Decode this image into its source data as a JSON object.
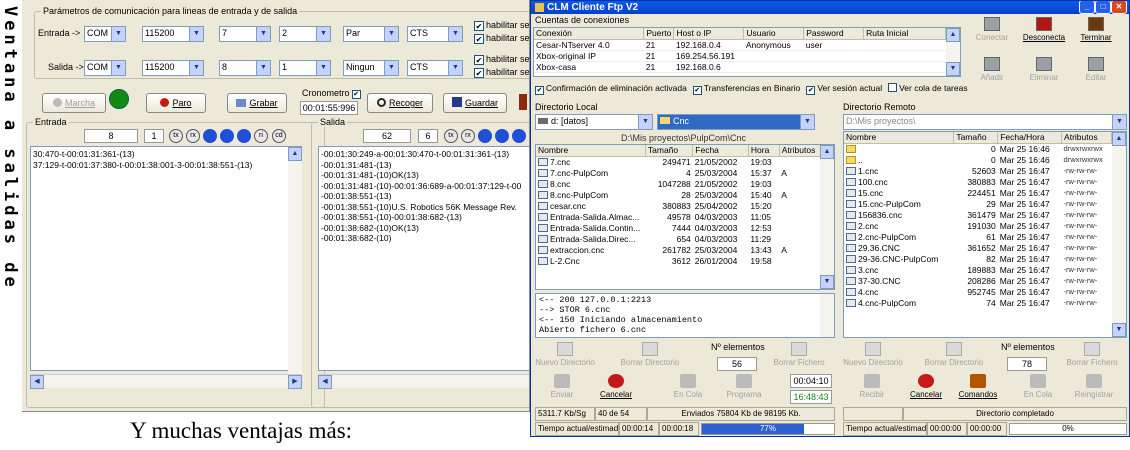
{
  "side_text": "Ventana a salidas de",
  "caption": "Y muchas ventajas más:",
  "serial": {
    "params_title": "Parámetros de comunicación para lineas de entrada y de salida",
    "entrada_label": "Entrada ->",
    "salida_label": "Salida ->",
    "entrada_combos": [
      "COM 3",
      "115200",
      "7",
      "2",
      "Par",
      "CTS"
    ],
    "salida_combos": [
      "COM 2",
      "115200",
      "8",
      "1",
      "Ningun",
      "CTS"
    ],
    "habilitar_labels": [
      "habilitar se",
      "habilitar se",
      "habilitar se",
      "habilitar se"
    ],
    "marcha": "Marcha",
    "paro": "Paro",
    "grabar": "Grabar",
    "cronometro_label": "Cronometro",
    "cronometro_value": "00:01:55:996",
    "recoger": "Recoger",
    "guardar": "Guardar",
    "entrada_group": "Entrada",
    "salida_group": "Salida",
    "entrada_count1": "8",
    "entrada_count2": "1",
    "salida_count1": "62",
    "salida_count2": "6",
    "indicators": [
      "tx",
      "rx",
      "ri",
      "cd"
    ],
    "entrada_lines": [
      "30:470-t-00:01:31:361-(13)",
      "37:129-t-00:01:37:380-t-00:01:38:001-3-00:01:38:551-(13)"
    ],
    "salida_lines": [
      "-00:01:30:249-a-00:01:30:470-t-00:01:31:361-(13)",
      "-00:01:31:481-(13)",
      "-00:01:31:481-(10)OK(13)",
      "-00:01:31:481-(10)-00:01:36:689-a-00:01:37:129-t-00",
      "-00:01:38:551-(13)",
      "-00:01:38:551-(10)U.S. Robotics 56K Message Rev.",
      "-00:01:38:551-(10)-00:01:38:682-(13)",
      "-00:01:38:682-(10)OK(13)",
      "-00:01:38:682-(10)"
    ]
  },
  "ftp": {
    "title": "CLM Cliente Ftp V2",
    "cuentas": "Cuentas de conexiones",
    "conn_headers": [
      "Conexión",
      "Puerto",
      "Host o IP",
      "Usuario",
      "Password",
      "Ruta Inicial"
    ],
    "conn_rows": [
      [
        "Cesar-NTserver 4.0",
        "21",
        "192.168.0.4",
        "Anonymous",
        "user",
        ""
      ],
      [
        "Xbox-original IP",
        "21",
        "169.254.56.191",
        "",
        "",
        ""
      ],
      [
        "Xbox-casa",
        "21",
        "192.168.0.6",
        "",
        "",
        ""
      ]
    ],
    "tools_top": [
      {
        "label": "Conectar",
        "enabled": false,
        "icon": "connect-icon"
      },
      {
        "label": "Desconecta",
        "enabled": true,
        "icon": "disconnect-icon"
      },
      {
        "label": "Terminar",
        "enabled": true,
        "icon": "exit-door-icon"
      },
      {
        "label": "Añadir",
        "enabled": false,
        "icon": "add-icon"
      },
      {
        "label": "Eliminar",
        "enabled": false,
        "icon": "remove-icon"
      },
      {
        "label": "Editar",
        "enabled": false,
        "icon": "edit-icon"
      }
    ],
    "options": [
      "Confirmación de eliminación activada",
      "Transferencias en Binario",
      "Ver sesión actual",
      "Ver cola de tareas"
    ],
    "options_checked": [
      true,
      true,
      true,
      false
    ],
    "local_title": "Directorio Local",
    "remote_title": "Directorio Remoto",
    "local_drive": "d: [datos]",
    "local_dir": "Cnc",
    "local_path": "D:\\Mis proyectos\\PulpCom\\Cnc",
    "remote_path": "D:\\Mis proyectos\\",
    "local_headers": [
      "Nombre",
      "Tamaño",
      "Fecha",
      "Hora",
      "Atributos"
    ],
    "local_rows": [
      [
        "7.cnc",
        "249471",
        "21/05/2002",
        "19:03",
        ""
      ],
      [
        "7.cnc-PulpCom",
        "4",
        "25/03/2004",
        "15:37",
        "A"
      ],
      [
        "8.cnc",
        "1047288",
        "21/05/2002",
        "19:03",
        ""
      ],
      [
        "8.cnc-PulpCom",
        "28",
        "25/03/2004",
        "15:40",
        "A"
      ],
      [
        "cesar.cnc",
        "380883",
        "25/04/2002",
        "15:20",
        ""
      ],
      [
        "Entrada-Salida.Almac...",
        "49578",
        "04/03/2003",
        "11:05",
        ""
      ],
      [
        "Entrada-Salida.Contin...",
        "7444",
        "04/03/2003",
        "12:53",
        ""
      ],
      [
        "Entrada-Salida.Direc...",
        "654",
        "04/03/2003",
        "11:29",
        ""
      ],
      [
        "extraccion.cnc",
        "261782",
        "25/03/2004",
        "13:43",
        "A"
      ],
      [
        "L-2.Cnc",
        "3612",
        "26/01/2004",
        "19:58",
        ""
      ]
    ],
    "remote_headers": [
      "Nombre",
      "Tamaño",
      "Fecha/Hora",
      "Atributos"
    ],
    "remote_rows": [
      [
        "",
        "0",
        "Mar 25 16:46",
        "drwxrwxrwx",
        "folder"
      ],
      [
        "..",
        "0",
        "Mar 25 16:46",
        "drwxrwxrwx",
        "folder"
      ],
      [
        "1.cnc",
        "52603",
        "Mar 25 16:47",
        "-rw-rw-rw-",
        "file"
      ],
      [
        "100.cnc",
        "380883",
        "Mar 25 16:47",
        "-rw-rw-rw-",
        "file"
      ],
      [
        "15.cnc",
        "224451",
        "Mar 25 16:47",
        "-rw-rw-rw-",
        "file"
      ],
      [
        "15.cnc-PulpCom",
        "29",
        "Mar 25 16:47",
        "-rw-rw-rw-",
        "file"
      ],
      [
        "156836.cnc",
        "361479",
        "Mar 25 16:47",
        "-rw-rw-rw-",
        "file"
      ],
      [
        "2.cnc",
        "191030",
        "Mar 25 16:47",
        "-rw-rw-rw-",
        "file"
      ],
      [
        "2.cnc-PulpCom",
        "61",
        "Mar 25 16:47",
        "-rw-rw-rw-",
        "file"
      ],
      [
        "29.36.CNC",
        "361652",
        "Mar 25 16:47",
        "-rw-rw-rw-",
        "file"
      ],
      [
        "29-36.CNC-PulpCom",
        "82",
        "Mar 25 16:47",
        "-rw-rw-rw-",
        "file"
      ],
      [
        "3.cnc",
        "189883",
        "Mar 25 16:47",
        "-rw-rw-rw-",
        "file"
      ],
      [
        "37-30.CNC",
        "208286",
        "Mar 25 16:47",
        "-rw-rw-rw-",
        "file"
      ],
      [
        "4.cnc",
        "952745",
        "Mar 25 16:47",
        "-rw-rw-rw-",
        "file"
      ],
      [
        "4.cnc-PulpCom",
        "74",
        "Mar 25 16:47",
        "-rw-rw-rw-",
        "file"
      ]
    ],
    "log_lines": [
      "<-- 200 127.0.0.1:2213",
      "--> STOR 6.cnc",
      "<-- 150 Iniciando almacenamiento",
      "Abierto fichero 6.cnc"
    ],
    "local_actions": [
      "Nuevo Directorio",
      "Borrar Directorio",
      "Borrar Fichero"
    ],
    "nelementos_label": "Nº elementos",
    "local_count": "56",
    "remote_actions": [
      "Nuevo Directorio",
      "Borrar Directorio",
      "Borrar Fichero"
    ],
    "remote_count": "78",
    "left_transfer": [
      {
        "label": "Enviar",
        "enabled": false
      },
      {
        "label": "Cancelar",
        "enabled": true
      },
      {
        "label": "En Cola",
        "enabled": false
      },
      {
        "label": "Programa",
        "enabled": false
      }
    ],
    "time1": "00:04:10",
    "time2": "16:48:43",
    "right_transfer": [
      {
        "label": "Recibir",
        "enabled": false
      },
      {
        "label": "Cancelar",
        "enabled": true
      },
      {
        "label": "Comandos",
        "enabled": true
      },
      {
        "label": "En Cola",
        "enabled": false
      },
      {
        "label": "Reingistrar",
        "enabled": false
      }
    ],
    "speed": "5311.7 Kb/Sg",
    "part": "40 de 54",
    "sent": "Enviados 75804 Kb de 98195 Kb.",
    "dir_done": "Directorio completado",
    "tiempo_label": "Tiempo actual/estimado",
    "left_times": [
      "00:00:14",
      "00:00:18"
    ],
    "left_progress_label": "77%",
    "left_progress": 0.77,
    "right_times": [
      "00:00:00",
      "00:00:00"
    ],
    "right_progress_label": "0%",
    "right_progress": 0.0
  }
}
